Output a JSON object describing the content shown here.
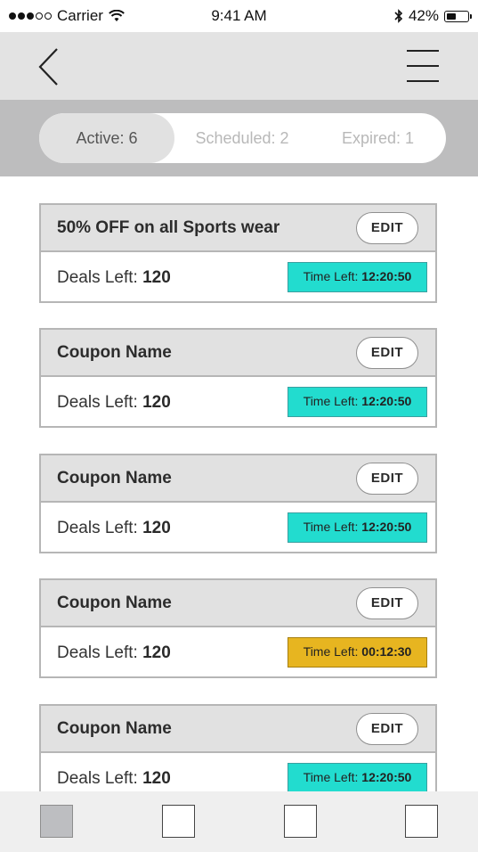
{
  "status_bar": {
    "carrier": "Carrier",
    "time": "9:41 AM",
    "battery": "42%"
  },
  "nav": {
    "back_icon": "chevron-left-icon",
    "menu_icon": "hamburger-menu-icon"
  },
  "segments": [
    {
      "label": "Active: 6",
      "active": true
    },
    {
      "label": "Scheduled: 2",
      "active": false
    },
    {
      "label": "Expired: 1",
      "active": false
    }
  ],
  "cards": [
    {
      "title": "50% OFF on all Sports wear",
      "edit": "EDIT",
      "deals_label": "Deals Left:",
      "deals_value": "120",
      "time_label": "Time Left:",
      "time_value": "12:20:50",
      "status": "ok"
    },
    {
      "title": "Coupon Name",
      "edit": "EDIT",
      "deals_label": "Deals Left:",
      "deals_value": "120",
      "time_label": "Time Left:",
      "time_value": "12:20:50",
      "status": "ok"
    },
    {
      "title": "Coupon Name",
      "edit": "EDIT",
      "deals_label": "Deals Left:",
      "deals_value": "120",
      "time_label": "Time Left:",
      "time_value": "12:20:50",
      "status": "ok"
    },
    {
      "title": "Coupon Name",
      "edit": "EDIT",
      "deals_label": "Deals Left:",
      "deals_value": "120",
      "time_label": "Time Left:",
      "time_value": "00:12:30",
      "status": "warning"
    },
    {
      "title": "Coupon Name",
      "edit": "EDIT",
      "deals_label": "Deals Left:",
      "deals_value": "120",
      "time_label": "Time Left:",
      "time_value": "12:20:50",
      "status": "ok"
    }
  ],
  "colors": {
    "timer_ok": "#22dccf",
    "timer_warning": "#e7b520",
    "nav_bg": "#e3e3e3",
    "segment_bg": "#bdbdbe"
  },
  "tab_bar": [
    {
      "name": "tab-1",
      "active": true
    },
    {
      "name": "tab-2",
      "active": false
    },
    {
      "name": "tab-3",
      "active": false
    },
    {
      "name": "tab-4",
      "active": false
    }
  ]
}
